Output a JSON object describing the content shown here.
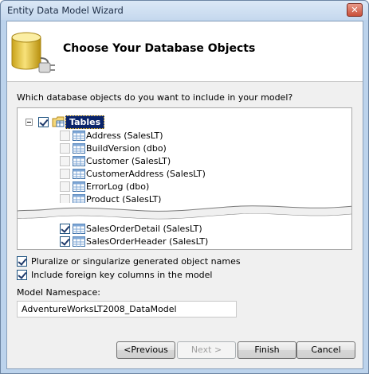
{
  "window": {
    "title": "Entity Data Model Wizard",
    "close_glyph": "✕"
  },
  "header": {
    "title": "Choose Your Database Objects",
    "icon": "database-plug-icon"
  },
  "prompt": "Which database objects do you want to include in your model?",
  "tree": {
    "root": {
      "label": "Tables",
      "checked": true,
      "expanded": true,
      "selected": true
    },
    "items_unchecked": [
      {
        "label": "Address (SalesLT)",
        "checked": false
      },
      {
        "label": "BuildVersion (dbo)",
        "checked": false
      },
      {
        "label": "Customer (SalesLT)",
        "checked": false
      },
      {
        "label": "CustomerAddress (SalesLT)",
        "checked": false
      },
      {
        "label": "ErrorLog (dbo)",
        "checked": false
      },
      {
        "label": "Product (SalesLT)",
        "checked": false
      }
    ],
    "items_checked": [
      {
        "label": "SalesOrderDetail (SalesLT)",
        "checked": true
      },
      {
        "label": "SalesOrderHeader (SalesLT)",
        "checked": true
      }
    ]
  },
  "options": {
    "pluralize": {
      "label": "Pluralize or singularize generated object names",
      "checked": true
    },
    "foreign_keys": {
      "label": "Include foreign key columns in the model",
      "checked": true
    }
  },
  "namespace": {
    "label": "Model Namespace:",
    "value": "AdventureWorksLT2008_DataModel"
  },
  "buttons": {
    "previous": "<Previous",
    "next": "Next >",
    "finish": "Finish",
    "cancel": "Cancel"
  },
  "colors": {
    "selection": "#0a246a",
    "frame": "#bcd3ec",
    "dialog_bg": "#f0f0f0"
  }
}
